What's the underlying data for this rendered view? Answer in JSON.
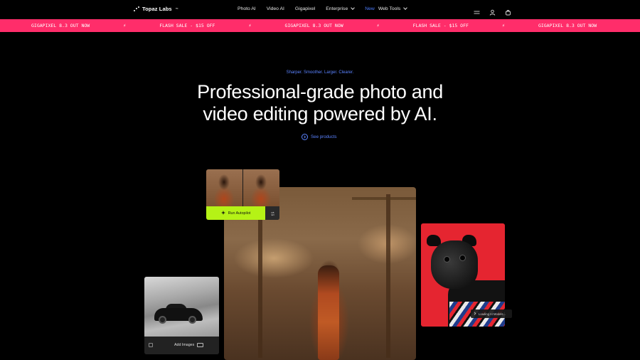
{
  "nav": {
    "logo": "Topaz Labs",
    "logo_tm": "™",
    "links": [
      {
        "label": "Photo AI"
      },
      {
        "label": "Video AI"
      },
      {
        "label": "Gigapixel"
      },
      {
        "label": "Enterprise"
      },
      {
        "badge": "New",
        "label": "Web Tools"
      }
    ],
    "icons": [
      "menu-icon",
      "user-icon",
      "cart-icon"
    ]
  },
  "marquee": {
    "items": [
      "GIGAPIXEL 8.3 OUT NOW",
      "FLASH SALE - $15 OFF",
      "GIGAPIXEL 8.3 OUT NOW",
      "FLASH SALE - $15 OFF",
      "GIGAPIXEL 8.3 OUT NOW"
    ],
    "separator": "⚡",
    "color": "#ff2d6a"
  },
  "hero": {
    "eyebrow": "Sharper. Smoother. Larger. Clearer.",
    "title_line1": "Professional-grade photo and",
    "title_line2": "video editing powered by AI.",
    "cta": "See products"
  },
  "cards": {
    "autopilot_label": "Run Autopilot",
    "add_images_label": "Add Images",
    "loading_label": "Loading AI Models..."
  },
  "colors": {
    "accent_blue": "#5b83ff",
    "lime": "#b5f216",
    "background": "#000000"
  }
}
